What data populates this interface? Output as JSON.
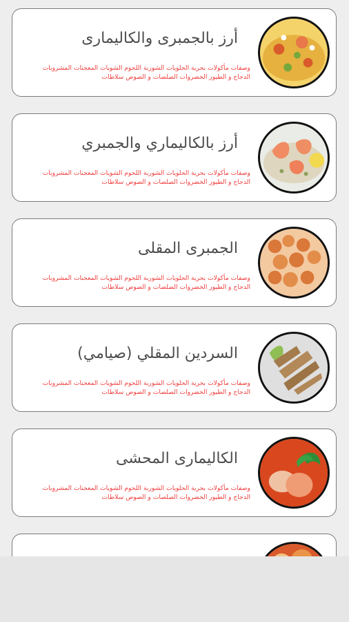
{
  "colors": {
    "background": "#eeeeee",
    "card": "#ffffff",
    "card_border": "#7a7a7a",
    "title_text": "#4d4d4d",
    "description_text": "#ef3f3f"
  },
  "recipes": [
    {
      "title": "أرز بالجمبرى والكاليمارى",
      "description": "وصفات مأكولات بحرية الحلويات الشوربة اللحوم الشويات المعجنات المشروبات الدجاج و الطيور الخضروات الصلصات و الصوص سلاطات",
      "image_icon": "shrimp-calamari-rice-image"
    },
    {
      "title": "أرز بالكاليماري والجمبري",
      "description": "وصفات مأكولات بحرية الحلويات الشوربة اللحوم الشويات المعجنات المشروبات الدجاج و الطيور الخضروات الصلصات و الصوص سلاطات",
      "image_icon": "calamari-shrimp-rice-image"
    },
    {
      "title": "الجمبرى المقلى",
      "description": "وصفات مأكولات بحرية الحلويات الشوربة اللحوم الشويات المعجنات المشروبات الدجاج و الطيور الخضروات الصلصات و الصوص سلاطات",
      "image_icon": "fried-shrimp-image"
    },
    {
      "title": "السردين المقلي (صيامي)",
      "description": "وصفات مأكولات بحرية الحلويات الشوربة اللحوم الشويات المعجنات المشروبات الدجاج و الطيور الخضروات الصلصات و الصوص سلاطات",
      "image_icon": "fried-sardines-image"
    },
    {
      "title": "الكاليمارى المحشى",
      "description": "وصفات مأكولات بحرية الحلويات الشوربة اللحوم الشويات المعجنات المشروبات الدجاج و الطيور الخضروات الصلصات و الصوص سلاطات",
      "image_icon": "stuffed-calamari-image"
    },
    {
      "title": "",
      "description": "",
      "image_icon": "partial-dish-image"
    }
  ]
}
